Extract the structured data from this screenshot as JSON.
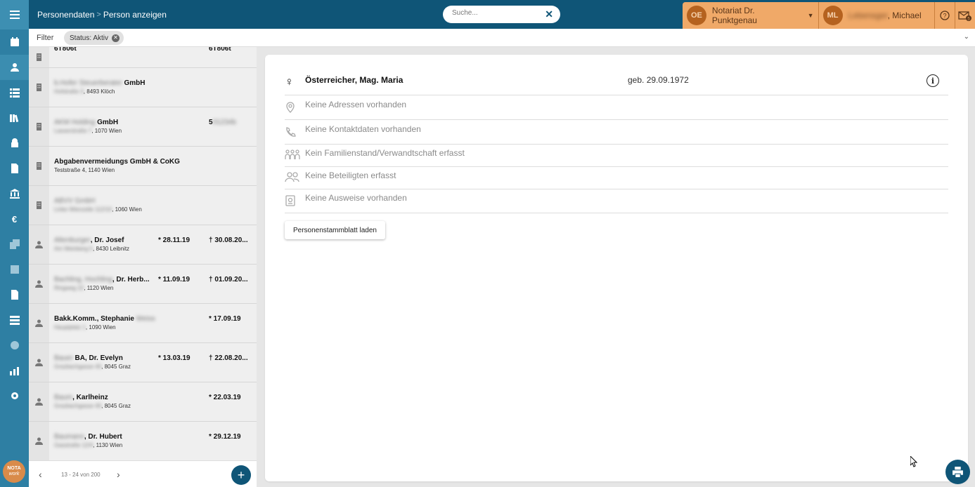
{
  "header": {
    "breadcrumb": [
      "Personendaten",
      "Person anzeigen"
    ],
    "search_placeholder": "Suche...",
    "org_initials": "OE",
    "org_name": "Notariat Dr. Punktgenau",
    "user_initials": "ML",
    "user_name_visible": ", Michael",
    "user_surname_redacted": "Lebensger",
    "mail_badge": "5"
  },
  "filter": {
    "label": "Filter",
    "chip": "Status: Aktiv"
  },
  "sidebar_icons": [
    "menu-icon",
    "calendar-check-icon",
    "person-icon",
    "list-icon",
    "books-icon",
    "safe-icon",
    "document-icon",
    "bank-icon",
    "euro-icon",
    "copy-icon",
    "square-icon",
    "file-icon",
    "table-icon",
    "info-icon",
    "chart-icon",
    "gear-icon"
  ],
  "logo": [
    "NOTA",
    "work"
  ],
  "list": {
    "rows": [
      {
        "type": "company",
        "name_prefix": "",
        "name": "6T806t",
        "addr_prefix": "",
        "addr": "",
        "col1": "",
        "col2": "6T806t"
      },
      {
        "type": "company",
        "name_prefix": "b.Hofer Steuerberater",
        "name": " GmbH",
        "addr_prefix": "Hofstraße 3",
        "addr": ", 8493 Klöch",
        "col1": "",
        "col2": ""
      },
      {
        "type": "company",
        "name_prefix": "AKM Holding",
        "name": " GmbH",
        "addr_prefix": "Lasserstraße 7",
        "addr": ", 1070 Wien",
        "col1": "",
        "col2": "5",
        "col2_suffix": "01234b"
      },
      {
        "type": "company",
        "name_prefix": "",
        "name": "Abgabenvermeidungs GmbH & CoKG",
        "addr_prefix": "",
        "addr": "Teststraße 4, 1140 Wien",
        "col1": "",
        "col2": ""
      },
      {
        "type": "company",
        "name_prefix": "ABVV GmbH",
        "name": "",
        "addr_prefix": "Linke Wienzeile 112/10",
        "addr": ", 1060 Wien",
        "col1": "",
        "col2": ""
      },
      {
        "type": "person",
        "name_prefix": "Altenburger",
        "name": ", Dr. Josef",
        "addr_prefix": "Am Weinberg 5",
        "addr": ", 8430 Leibnitz",
        "col1": "* 28.11.19",
        "col2": "† 30.08.20..."
      },
      {
        "type": "person",
        "name_prefix": "Bachling, Hochling",
        "name": ", Dr. Herb...",
        "addr_prefix": "Ringweg 22",
        "addr": ", 1120 Wien",
        "col1": "* 11.09.19",
        "col2": "† 01.09.20..."
      },
      {
        "type": "person",
        "name_prefix": "",
        "name": "Bakk.Komm., Stephanie",
        "name_suffix": "Weiss",
        "addr_prefix": "Hauptplatz 1",
        "addr": ", 1090 Wien",
        "col1": "",
        "col2": "* 17.09.19"
      },
      {
        "type": "person",
        "name_prefix": "Bauer",
        "name": " BA, Dr. Evelyn",
        "addr_prefix": "Grazbachgasse 40",
        "addr": ", 8045 Graz",
        "col1": "* 13.03.19",
        "col2": "† 22.08.20..."
      },
      {
        "type": "person",
        "name_prefix": "Baum",
        "name": ", Karlheinz",
        "addr_prefix": "Grazbachgasse 40",
        "addr": ", 8045 Graz",
        "col1": "",
        "col2": "* 22.03.19"
      },
      {
        "type": "person",
        "name_prefix": "Baumann",
        "name": ", Dr. Hubert",
        "addr_prefix": "Gasstraße 12/4",
        "addr": ", 1130 Wien",
        "col1": "",
        "col2": "* 29.12.19"
      }
    ],
    "pager_text": "13 - 24 von 200"
  },
  "person": {
    "sex_symbol": "♀",
    "name": "Österreicher, Mag. Maria",
    "birth": "geb. 29.09.1972",
    "lines": [
      {
        "icon": "location-pin-icon",
        "text": "Keine Adressen vorhanden"
      },
      {
        "icon": "phone-icon",
        "text": "Keine Kontaktdaten vorhanden"
      },
      {
        "icon": "family-icon",
        "text": "Kein Familienstand/Verwandtschaft erfasst"
      },
      {
        "icon": "people-icon",
        "text": "Keine Beteiligten erfasst"
      },
      {
        "icon": "id-card-icon",
        "text": "Keine Ausweise vorhanden"
      }
    ],
    "load_button": "Personenstammblatt laden"
  },
  "colors": {
    "rail": "#2e7fa3",
    "topbar": "#0f5577",
    "org_bg": "#f0a968",
    "avatar": "#b5621f"
  }
}
